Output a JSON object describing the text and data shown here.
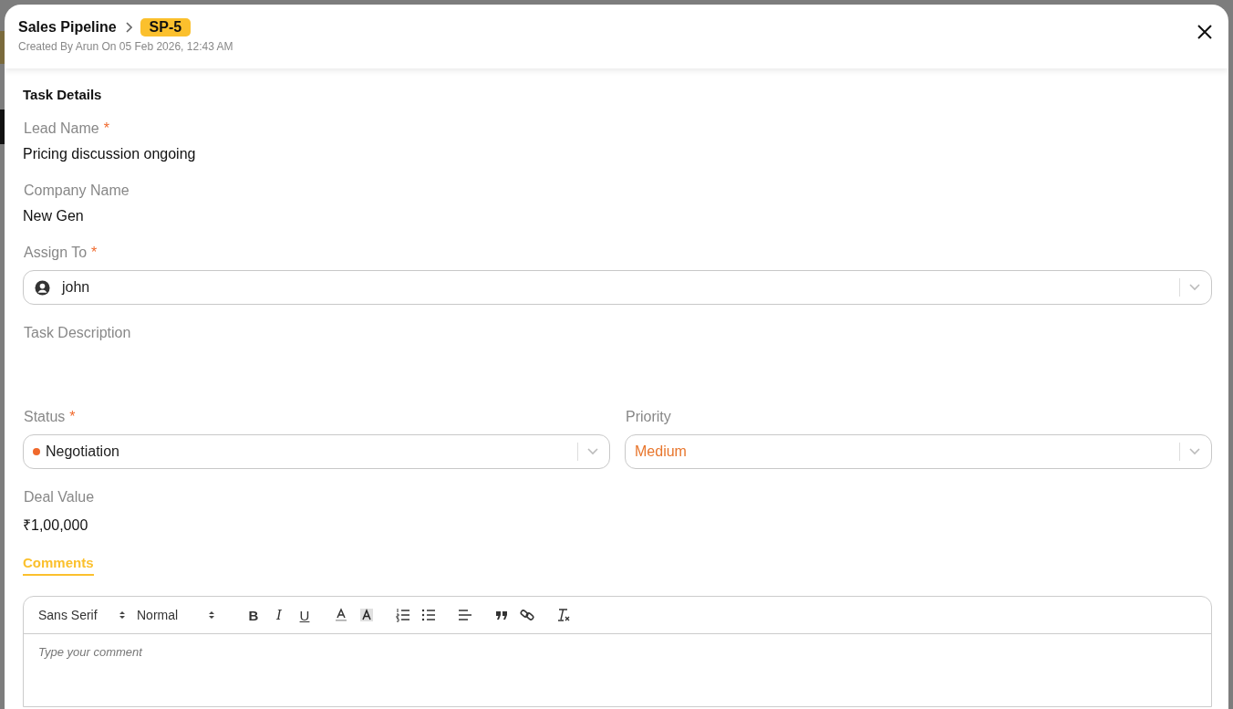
{
  "header": {
    "breadcrumb": "Sales Pipeline",
    "badge": "SP-5",
    "meta": "Created By Arun On 05 Feb 2026, 12:43 AM"
  },
  "section_title": "Task Details",
  "fields": [
    {
      "kind": "text",
      "label": "Lead Name",
      "required_mark": "*",
      "value": "Pricing discussion ongoing"
    },
    {
      "kind": "text",
      "label": "Company Name",
      "value": "New Gen"
    },
    {
      "kind": "user_select",
      "label": "Assign To",
      "required_mark": "*",
      "value": "john"
    },
    {
      "kind": "textarea",
      "label": "Task Description"
    },
    {
      "kind": "select_row",
      "items": [
        {
          "label": "Status",
          "required_mark": "*",
          "value": "Negotiation",
          "color": "#f0692c",
          "kind": "dot"
        },
        {
          "label": "Priority",
          "value": "Medium",
          "color": "#e8762d",
          "kind": "colored_text"
        }
      ]
    },
    {
      "kind": "text",
      "label": "Deal Value",
      "value": "₹1,00,000"
    }
  ],
  "tabs": [
    {
      "label": "Comments",
      "selected": true
    }
  ],
  "editor": {
    "font": "Sans Serif",
    "size": "Normal",
    "format_buttons": [
      "B",
      "I",
      "U"
    ],
    "placeholder": "Type your comment"
  }
}
